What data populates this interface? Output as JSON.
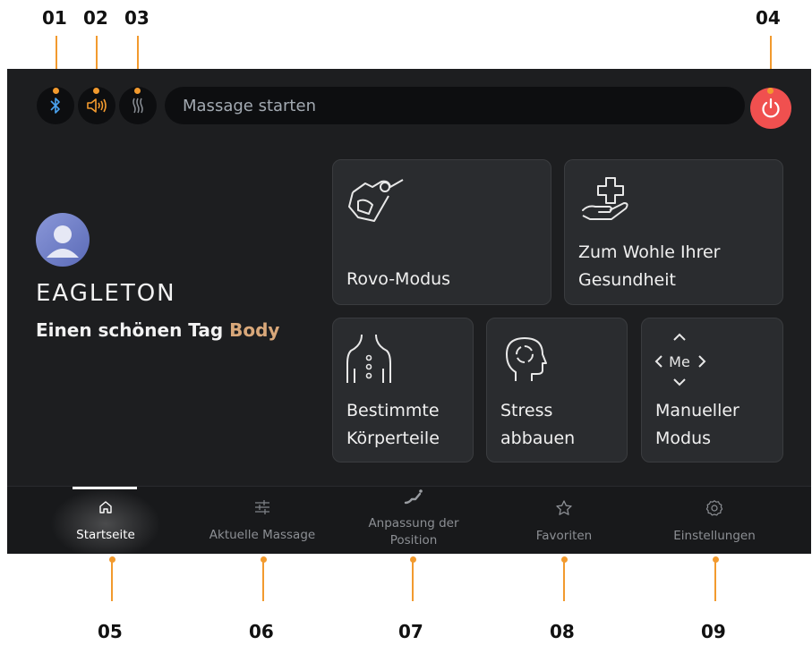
{
  "callouts": {
    "c01": "01",
    "c02": "02",
    "c03": "03",
    "c04": "04",
    "c05": "05",
    "c06": "06",
    "c07": "07",
    "c08": "08",
    "c09": "09"
  },
  "header": {
    "status_text": "Massage starten",
    "icons": [
      "bluetooth-icon",
      "volume-icon",
      "heat-icon",
      "power-icon"
    ]
  },
  "profile": {
    "brand": "EAGLETON",
    "greeting": "Einen schönen Tag",
    "user_name": "Body"
  },
  "cards": {
    "rovo": "Rovo-Modus",
    "health_line1": "Zum Wohle Ihrer",
    "health_line2": "Gesundheit",
    "body_line1": "Bestimmte",
    "body_line2": "Körperteile",
    "stress_line1": "Stress",
    "stress_line2": "abbauen",
    "manual_line1": "Manueller",
    "manual_line2": "Modus",
    "manual_icon_text": "Me"
  },
  "nav": {
    "home": "Startseite",
    "current": "Aktuelle Massage",
    "position_line1": "Anpassung der",
    "position_line2": "Position",
    "favorites": "Favoriten",
    "settings": "Einstellungen"
  },
  "colors": {
    "accent": "#f29a2e",
    "power": "#f0504f",
    "name_highlight": "#d9a87a",
    "bluetooth": "#4aa3f0"
  }
}
